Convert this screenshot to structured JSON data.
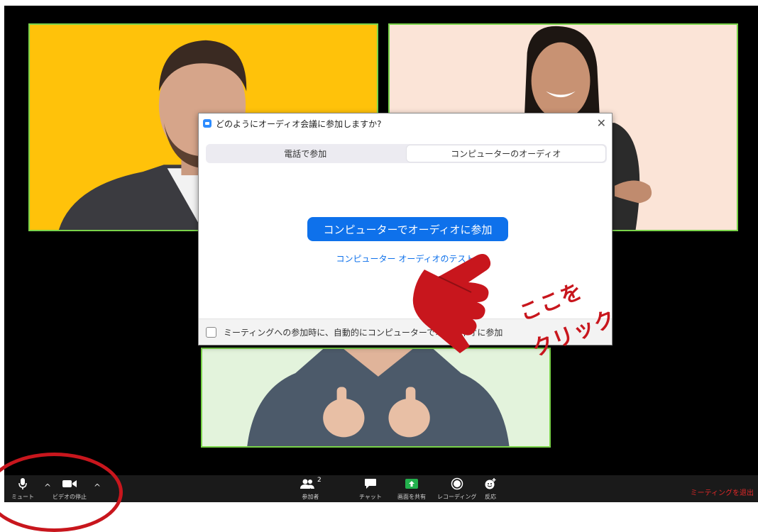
{
  "dialog": {
    "title": "どのようにオーディオ会議に参加しますか?",
    "tabs": [
      {
        "label": "電話で参加",
        "active": false
      },
      {
        "label": "コンピューターのオーディオ",
        "active": true
      }
    ],
    "join_button": "コンピューターでオーディオに参加",
    "test_link": "コンピューター オーディオのテスト",
    "auto_join_label": "ミーティングへの参加時に、自動的にコンピューターでオーディオに参加",
    "auto_join_checked": false
  },
  "annotation": {
    "line1": "ここを",
    "line2": "クリック",
    "color": "#c8161d"
  },
  "toolbar": {
    "mute_label": "ミュート",
    "video_label": "ビデオの停止",
    "participants_label": "参加者",
    "participants_count": "2",
    "chat_label": "チャット",
    "share_label": "画面を共有",
    "record_label": "レコーディング",
    "reactions_label": "反応",
    "leave_label": "ミーティングを退出"
  },
  "colors": {
    "accent": "#0e71eb",
    "tile_border": "#7ad34a",
    "share_green": "#23b14d",
    "leave_red": "#e02828"
  }
}
